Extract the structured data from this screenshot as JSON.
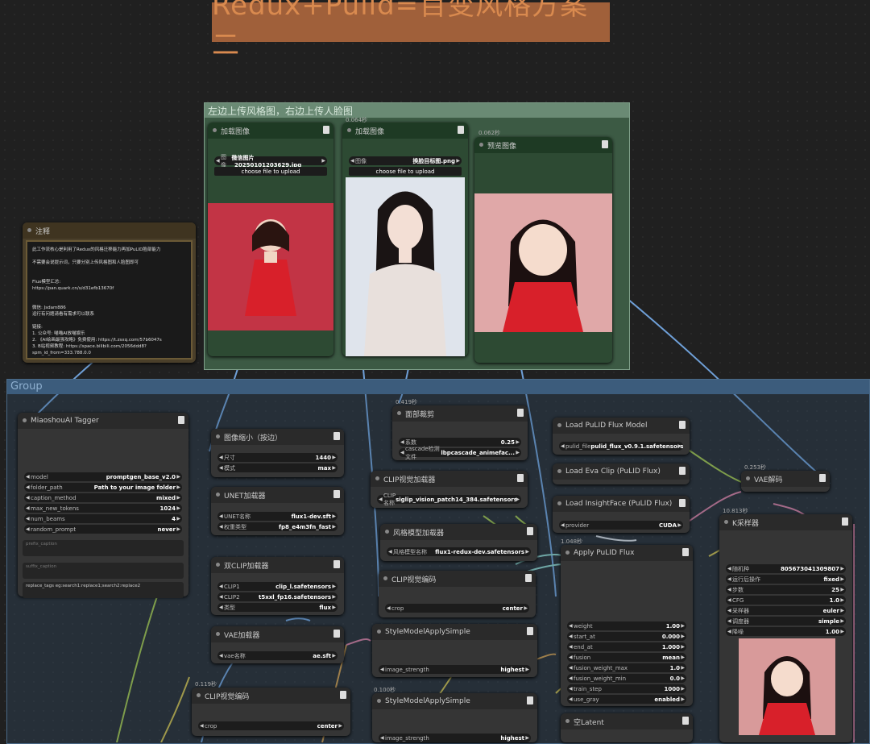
{
  "title": "Redux+Pulid=百变风格方案二",
  "groups": {
    "upload_group": "左边上传风格图，右边上传人脸图",
    "main_group": "Group"
  },
  "times": {
    "t1": "0.064秒",
    "t2": "0.062秒",
    "t3": "0.419秒",
    "t4": "0.253秒",
    "t5": "10.813秒",
    "t6": "1.048秒",
    "t7": "0.119秒",
    "t8": "0.100秒"
  },
  "load_image_1": {
    "title": "加载图像",
    "image_label": "图像",
    "image_value": "微信图片_20250101203629.jpg",
    "upload": "choose file to upload"
  },
  "load_image_2": {
    "title": "加载图像",
    "image_label": "图像",
    "image_value": "换脸目标图.png",
    "upload": "choose file to upload"
  },
  "preview": {
    "title": "预览图像"
  },
  "note": {
    "title": "注释",
    "body": "此工作流核心是利用了Redux的风格迁移能力再加PuLID脸部能力\n\n不需要会说提示词，只要分别上传风格图和人脸图即可\n\n\nFlux模型汇总:\nhttps://pan.quark.cn/s/d31efb13670f\n\n\n微信: Jsdam886\n运行有问题请看有需求可以联系\n\n链接:\n1. 公众号: 喵喵AI放喵娱乐\n2. 《AI绘画最强攻略》免费使用: https://t.zsxq.com/57b6047s\n3. B站视频教程: https://space.bilibili.com/2056ddd8?\nspm_id_from=333.788.0.0"
  },
  "tagger": {
    "title": "MiaoshouAI Tagger",
    "widgets": [
      {
        "label": "model",
        "value": "promptgen_base_v2.0"
      },
      {
        "label": "folder_path",
        "value": "Path to your image folder"
      },
      {
        "label": "caption_method",
        "value": "mixed"
      },
      {
        "label": "max_new_tokens",
        "value": "1024"
      },
      {
        "label": "num_beams",
        "value": "4"
      },
      {
        "label": "random_prompt",
        "value": "never"
      }
    ],
    "prefix_placeholder": "prefix_caption",
    "suffix_placeholder": "suffix_caption",
    "replace_text": "replace_tags eg:search1:replace1;search2:replace2"
  },
  "resize": {
    "title": "图像缩小（按边）",
    "w1_label": "尺寸",
    "w1_value": "1440",
    "w2_label": "模式",
    "w2_value": "max"
  },
  "unet": {
    "title": "UNET加载器",
    "w1_label": "UNET名称",
    "w1_value": "flux1-dev.sft",
    "w2_label": "权重类型",
    "w2_value": "fp8_e4m3fn_fast"
  },
  "dualclip": {
    "title": "双CLIP加载器",
    "w1_label": "CLIP1",
    "w1_value": "clip_l.safetensors",
    "w2_label": "CLIP2",
    "w2_value": "t5xxl_fp16.safetensors",
    "w3_label": "类型",
    "w3_value": "flux"
  },
  "vae_loader": {
    "title": "VAE加载器",
    "w1_label": "vae名称",
    "w1_value": "ae.sft"
  },
  "clip_encode_bottom": {
    "title": "CLIP视觉编码",
    "w1_label": "crop",
    "w1_value": "center"
  },
  "face_crop": {
    "title": "面部裁剪",
    "w1_label": "系数",
    "w1_value": "0.25",
    "w2_label": "cascade检测文件",
    "w2_value": "lbpcascade_animefac..."
  },
  "clip_vision_loader": {
    "title": "CLIP视觉加载器",
    "w1_label": "CLIP名称",
    "w1_value": "siglip_vision_patch14_384.safetensors"
  },
  "style_loader": {
    "title": "风格模型加载器",
    "w1_label": "风格模型名称",
    "w1_value": "flux1-redux-dev.safetensors"
  },
  "clip_encode_mid": {
    "title": "CLIP视觉编码",
    "w1_label": "crop",
    "w1_value": "center"
  },
  "style_apply_1": {
    "title": "StyleModelApplySimple",
    "w1_label": "image_strength",
    "w1_value": "highest"
  },
  "style_apply_2": {
    "title": "StyleModelApplySimple",
    "w1_label": "image_strength",
    "w1_value": "highest"
  },
  "pulid_model": {
    "title": "Load PuLID Flux Model",
    "w1_label": "pulid_file",
    "w1_value": "pulid_flux_v0.9.1.safetensors"
  },
  "eva_clip": {
    "title": "Load Eva Clip (PuLID Flux)"
  },
  "insightface": {
    "title": "Load InsightFace (PuLID Flux)",
    "w1_label": "provider",
    "w1_value": "CUDA"
  },
  "apply_pulid": {
    "title": "Apply PuLID Flux",
    "widgets": [
      {
        "label": "weight",
        "value": "1.00"
      },
      {
        "label": "start_at",
        "value": "0.000"
      },
      {
        "label": "end_at",
        "value": "1.000"
      },
      {
        "label": "fusion",
        "value": "mean"
      },
      {
        "label": "fusion_weight_max",
        "value": "1.0"
      },
      {
        "label": "fusion_weight_min",
        "value": "0.0"
      },
      {
        "label": "train_step",
        "value": "1000"
      },
      {
        "label": "use_gray",
        "value": "enabled"
      }
    ]
  },
  "empty_latent": {
    "title": "空Latent"
  },
  "vae_decode": {
    "title": "VAE解码"
  },
  "ksampler": {
    "title": "K采样器",
    "widgets": [
      {
        "label": "随机种",
        "value": "805673041309807"
      },
      {
        "label": "运行后操作",
        "value": "fixed"
      },
      {
        "label": "步数",
        "value": "25"
      },
      {
        "label": "CFG",
        "value": "1.0"
      },
      {
        "label": "采样器",
        "value": "euler"
      },
      {
        "label": "调度器",
        "value": "simple"
      },
      {
        "label": "降噪",
        "value": "1.00"
      }
    ]
  }
}
